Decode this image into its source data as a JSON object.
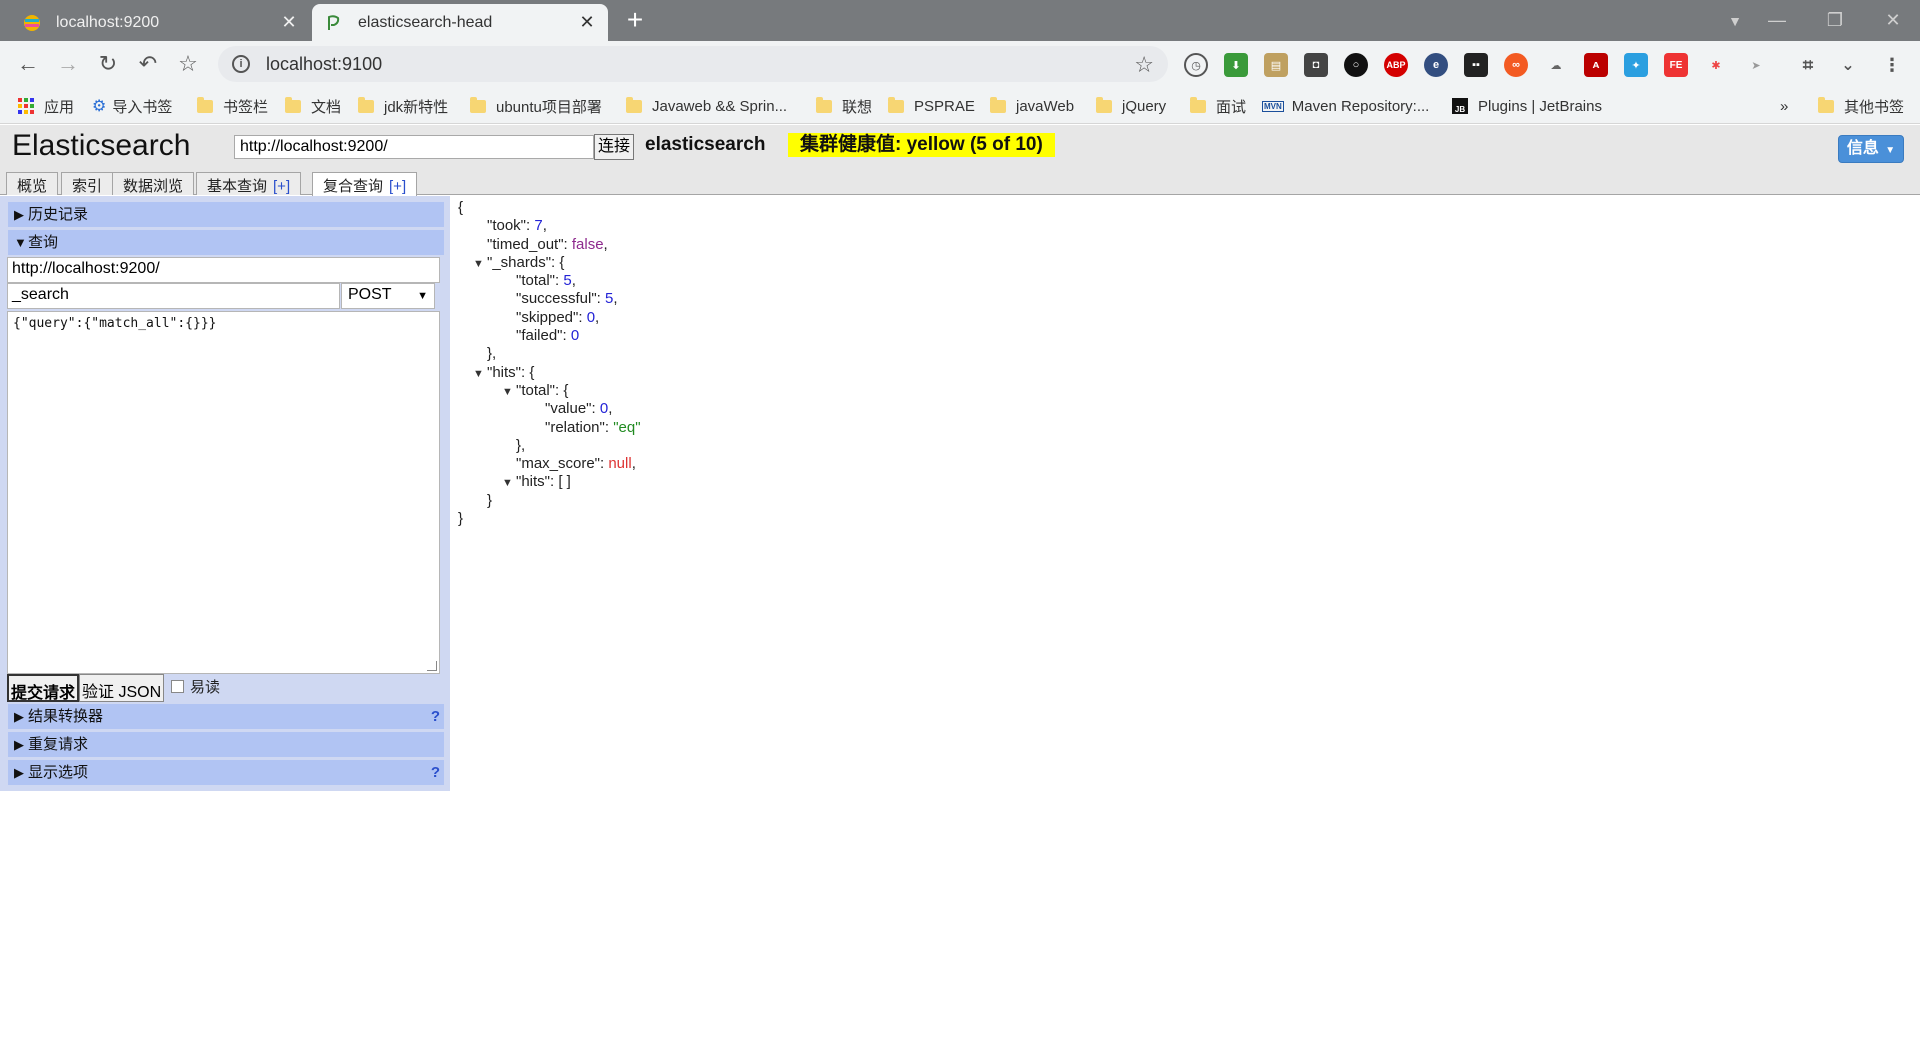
{
  "browser": {
    "tabs": [
      {
        "title": "localhost:9200",
        "active": false
      },
      {
        "title": "elasticsearch-head",
        "active": true
      }
    ],
    "address": "localhost:9100",
    "bookmarks": [
      "应用",
      "导入书签",
      "书签栏",
      "文档",
      "jdk新特性",
      "ubuntu项目部署",
      "Javaweb && Sprin...",
      "联想",
      "PSPRAE",
      "javaWeb",
      "jQuery",
      "面试",
      "Maven Repository:...",
      "Plugins | JetBrains",
      "»",
      "其他书签"
    ],
    "extensions": [
      "history",
      "download",
      "image",
      "mask",
      "circle",
      "ABP",
      "e",
      "gamepad",
      "infinity",
      "cloud",
      "pdf",
      "bird",
      "FE",
      "pinwheel",
      "plane"
    ]
  },
  "es": {
    "logo": "Elasticsearch",
    "cluster_url": "http://localhost:9200/",
    "connect_label": "连接",
    "cluster_name": "elasticsearch",
    "health": "集群健康值: yellow (5 of 10)",
    "health_color": "#ffff00",
    "info_label": "信息",
    "tabs": [
      {
        "label": "概览"
      },
      {
        "label": "索引"
      },
      {
        "label": "数据浏览"
      },
      {
        "label": "基本查询",
        "plus": "[+]"
      },
      {
        "label": "复合查询",
        "plus": "[+]"
      }
    ],
    "sections": {
      "history": "历史记录",
      "query": "查询",
      "transformer": "结果转换器",
      "repeat": "重复请求",
      "display": "显示选项",
      "help": "?"
    },
    "query": {
      "url": "http://localhost:9200/",
      "path": "_search",
      "method": "POST",
      "body": "{\"query\":{\"match_all\":{}}}",
      "submit_label": "提交请求",
      "validate_label": "验证 JSON",
      "pretty_label": "易读"
    },
    "json_lines": [
      {
        "indent": 0,
        "tri": false,
        "parts": [
          [
            "p",
            "{"
          ]
        ]
      },
      {
        "indent": 1,
        "tri": false,
        "parts": [
          [
            "k",
            "\"took\": "
          ],
          [
            "num",
            "7"
          ],
          [
            "p",
            ","
          ]
        ]
      },
      {
        "indent": 1,
        "tri": false,
        "parts": [
          [
            "k",
            "\"timed_out\": "
          ],
          [
            "bool",
            "false"
          ],
          [
            "p",
            ","
          ]
        ]
      },
      {
        "indent": 1,
        "tri": true,
        "parts": [
          [
            "k",
            "\"_shards\": {"
          ]
        ]
      },
      {
        "indent": 2,
        "tri": false,
        "parts": [
          [
            "k",
            "\"total\": "
          ],
          [
            "num",
            "5"
          ],
          [
            "p",
            ","
          ]
        ]
      },
      {
        "indent": 2,
        "tri": false,
        "parts": [
          [
            "k",
            "\"successful\": "
          ],
          [
            "num",
            "5"
          ],
          [
            "p",
            ","
          ]
        ]
      },
      {
        "indent": 2,
        "tri": false,
        "parts": [
          [
            "k",
            "\"skipped\": "
          ],
          [
            "num",
            "0"
          ],
          [
            "p",
            ","
          ]
        ]
      },
      {
        "indent": 2,
        "tri": false,
        "parts": [
          [
            "k",
            "\"failed\": "
          ],
          [
            "num",
            "0"
          ]
        ]
      },
      {
        "indent": 1,
        "tri": false,
        "parts": [
          [
            "p",
            "},"
          ]
        ]
      },
      {
        "indent": 1,
        "tri": true,
        "parts": [
          [
            "k",
            "\"hits\": {"
          ]
        ]
      },
      {
        "indent": 2,
        "tri": true,
        "parts": [
          [
            "k",
            "\"total\": {"
          ]
        ]
      },
      {
        "indent": 3,
        "tri": false,
        "parts": [
          [
            "k",
            "\"value\": "
          ],
          [
            "num",
            "0"
          ],
          [
            "p",
            ","
          ]
        ]
      },
      {
        "indent": 3,
        "tri": false,
        "parts": [
          [
            "k",
            "\"relation\": "
          ],
          [
            "str",
            "\"eq\""
          ]
        ]
      },
      {
        "indent": 2,
        "tri": false,
        "parts": [
          [
            "p",
            "},"
          ]
        ]
      },
      {
        "indent": 2,
        "tri": false,
        "parts": [
          [
            "k",
            "\"max_score\": "
          ],
          [
            "null",
            "null"
          ],
          [
            "p",
            ","
          ]
        ]
      },
      {
        "indent": 2,
        "tri": true,
        "parts": [
          [
            "k",
            "\"hits\": [ ]"
          ]
        ]
      },
      {
        "indent": 1,
        "tri": false,
        "parts": [
          [
            "p",
            "}"
          ]
        ]
      },
      {
        "indent": 0,
        "tri": false,
        "parts": [
          [
            "p",
            "}"
          ]
        ]
      }
    ]
  }
}
